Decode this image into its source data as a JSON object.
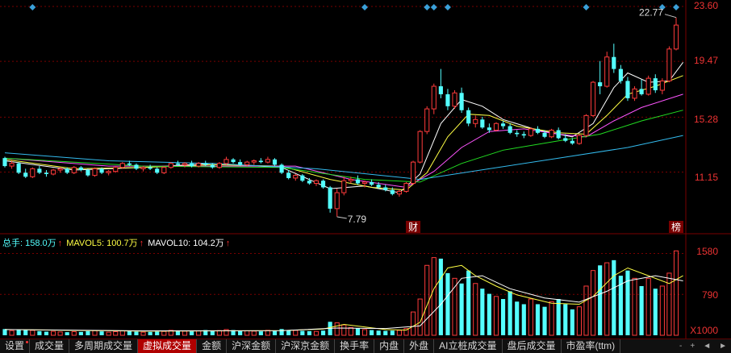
{
  "price_axis": {
    "labels": [
      "23.60",
      "19.47",
      "15.28",
      "11.15"
    ]
  },
  "volume_axis": {
    "labels": [
      "1580",
      "790",
      "X1000"
    ]
  },
  "annotations": {
    "high": "22.77",
    "low": "7.79",
    "finance_marker": "财",
    "ranking_marker": "榜"
  },
  "legend": {
    "total_label": "总手: 158.0万",
    "mavol5_label": "MAVOL5: 100.7万",
    "mavol10_label": "MAVOL10: 104.2万",
    "arrow_glyph": "↑"
  },
  "colors": {
    "up": "#ff3b3b",
    "down": "#54ffff",
    "ma5": "#ffffff",
    "ma10": "#ffff44",
    "ma20": "#ff55ff",
    "ma30": "#22dd22",
    "ma60": "#33bbee",
    "grid": "#7a0000"
  },
  "tabs": [
    {
      "label": "设置",
      "active": false
    },
    {
      "label": "成交量",
      "active": false
    },
    {
      "label": "多周期成交量",
      "active": false
    },
    {
      "label": "虚拟成交量",
      "active": true
    },
    {
      "label": "金额",
      "active": false
    },
    {
      "label": "沪深金额",
      "active": false
    },
    {
      "label": "沪深京金额",
      "active": false
    },
    {
      "label": "换手率",
      "active": false
    },
    {
      "label": "内盘",
      "active": false
    },
    {
      "label": "外盘",
      "active": false
    },
    {
      "label": "AI立桩成交量",
      "active": false
    },
    {
      "label": "盘后成交量",
      "active": false
    },
    {
      "label": "市盈率(ttm)",
      "active": false
    }
  ],
  "tab_controls": {
    "minus_icon": "-",
    "plus_icon": "+",
    "left_icon": "◄",
    "right_icon": "►"
  },
  "chart_data": {
    "type": "candlestick",
    "price_ylim": [
      7.0,
      23.6
    ],
    "volume_ylim": [
      0,
      1650
    ],
    "price_ticks": [
      23.6,
      19.47,
      15.28,
      11.15
    ],
    "volume_ticks": [
      1580,
      790
    ],
    "bars": [
      [
        12.2,
        12.3,
        11.5,
        11.6,
        120
      ],
      [
        11.6,
        12.0,
        11.4,
        11.8,
        90
      ],
      [
        11.8,
        11.9,
        11.0,
        11.1,
        110
      ],
      [
        11.1,
        11.4,
        10.7,
        10.8,
        100
      ],
      [
        10.8,
        11.5,
        10.7,
        11.4,
        95
      ],
      [
        11.4,
        11.6,
        11.0,
        11.1,
        80
      ],
      [
        11.1,
        11.3,
        10.8,
        11.0,
        70
      ],
      [
        11.0,
        11.4,
        10.9,
        11.3,
        75
      ],
      [
        11.3,
        11.5,
        11.1,
        11.4,
        65
      ],
      [
        11.4,
        11.5,
        11.0,
        11.1,
        60
      ],
      [
        11.1,
        11.6,
        11.0,
        11.5,
        70
      ],
      [
        11.5,
        11.6,
        11.2,
        11.3,
        65
      ],
      [
        11.3,
        11.4,
        10.8,
        10.9,
        80
      ],
      [
        10.9,
        11.5,
        10.8,
        11.4,
        90
      ],
      [
        11.4,
        11.5,
        11.0,
        11.1,
        75
      ],
      [
        11.1,
        11.3,
        10.9,
        11.2,
        60
      ],
      [
        11.2,
        11.6,
        11.1,
        11.5,
        70
      ],
      [
        11.5,
        11.9,
        11.4,
        11.8,
        85
      ],
      [
        11.8,
        12.0,
        11.6,
        11.7,
        80
      ],
      [
        11.7,
        11.8,
        11.3,
        11.4,
        70
      ],
      [
        11.4,
        11.6,
        11.2,
        11.5,
        60
      ],
      [
        11.5,
        11.7,
        11.3,
        11.4,
        65
      ],
      [
        11.4,
        11.5,
        11.0,
        11.1,
        70
      ],
      [
        11.1,
        11.6,
        11.0,
        11.5,
        75
      ],
      [
        11.5,
        11.9,
        11.4,
        11.8,
        95
      ],
      [
        11.8,
        12.0,
        11.6,
        11.7,
        90
      ],
      [
        11.7,
        11.9,
        11.5,
        11.8,
        80
      ],
      [
        11.8,
        12.0,
        11.5,
        11.6,
        75
      ],
      [
        11.6,
        11.9,
        11.5,
        11.8,
        85
      ],
      [
        11.8,
        12.0,
        11.6,
        11.7,
        100
      ],
      [
        11.7,
        11.8,
        11.4,
        11.5,
        80
      ],
      [
        11.5,
        11.9,
        11.4,
        11.8,
        90
      ],
      [
        11.8,
        12.3,
        11.7,
        12.1,
        110
      ],
      [
        12.1,
        12.2,
        11.8,
        11.9,
        100
      ],
      [
        11.9,
        12.1,
        11.6,
        11.7,
        90
      ],
      [
        11.7,
        12.0,
        11.6,
        11.9,
        85
      ],
      [
        11.9,
        12.1,
        11.7,
        12.0,
        80
      ],
      [
        12.0,
        12.2,
        11.8,
        11.9,
        75
      ],
      [
        11.9,
        12.3,
        11.8,
        12.1,
        95
      ],
      [
        12.1,
        12.2,
        11.6,
        11.7,
        90
      ],
      [
        11.7,
        11.8,
        11.0,
        11.1,
        120
      ],
      [
        11.1,
        11.3,
        10.6,
        10.7,
        100
      ],
      [
        10.7,
        11.0,
        10.5,
        10.9,
        95
      ],
      [
        10.9,
        11.0,
        10.4,
        10.5,
        85
      ],
      [
        10.5,
        10.7,
        10.2,
        10.3,
        80
      ],
      [
        10.3,
        10.6,
        10.1,
        10.5,
        75
      ],
      [
        10.5,
        10.6,
        9.9,
        10.0,
        90
      ],
      [
        10.0,
        10.1,
        8.1,
        8.4,
        260
      ],
      [
        8.4,
        9.9,
        7.79,
        9.6,
        240
      ],
      [
        9.6,
        10.8,
        9.4,
        10.5,
        200
      ],
      [
        10.5,
        10.8,
        10.3,
        10.6,
        150
      ],
      [
        10.6,
        10.9,
        10.2,
        10.3,
        140
      ],
      [
        10.3,
        10.5,
        10.0,
        10.4,
        110
      ],
      [
        10.4,
        10.6,
        10.1,
        10.2,
        100
      ],
      [
        10.2,
        10.4,
        9.9,
        10.0,
        90
      ],
      [
        10.0,
        10.2,
        9.7,
        9.8,
        85
      ],
      [
        9.8,
        10.0,
        9.4,
        9.5,
        90
      ],
      [
        9.5,
        9.8,
        9.3,
        9.7,
        95
      ],
      [
        9.7,
        10.4,
        9.6,
        10.3,
        130
      ],
      [
        10.3,
        12.0,
        10.2,
        11.9,
        450
      ],
      [
        11.9,
        14.3,
        11.8,
        14.2,
        700
      ],
      [
        14.2,
        16.1,
        14.0,
        15.9,
        1350
      ],
      [
        15.9,
        17.8,
        15.5,
        17.6,
        1500
      ],
      [
        17.6,
        18.9,
        16.7,
        17.0,
        1480
      ],
      [
        17.0,
        17.4,
        15.8,
        16.1,
        1200
      ],
      [
        16.1,
        17.3,
        15.9,
        17.1,
        1100
      ],
      [
        17.1,
        17.5,
        15.6,
        15.8,
        1000
      ],
      [
        15.8,
        16.0,
        14.6,
        14.8,
        1250
      ],
      [
        14.8,
        15.4,
        14.5,
        15.1,
        1000
      ],
      [
        15.1,
        15.3,
        14.4,
        14.5,
        900
      ],
      [
        14.5,
        14.8,
        14.1,
        14.3,
        800
      ],
      [
        14.3,
        14.9,
        14.2,
        14.8,
        750
      ],
      [
        14.8,
        15.0,
        14.4,
        14.6,
        700
      ],
      [
        14.6,
        14.8,
        14.0,
        14.1,
        850
      ],
      [
        14.1,
        14.3,
        13.8,
        14.0,
        650
      ],
      [
        14.0,
        14.2,
        13.7,
        13.9,
        600
      ],
      [
        13.9,
        14.5,
        13.8,
        14.4,
        700
      ],
      [
        14.4,
        14.6,
        14.0,
        14.1,
        600
      ],
      [
        14.1,
        14.3,
        13.7,
        13.8,
        550
      ],
      [
        13.8,
        14.4,
        13.7,
        14.3,
        650
      ],
      [
        14.3,
        14.5,
        13.6,
        13.7,
        700
      ],
      [
        13.7,
        14.0,
        13.4,
        13.5,
        600
      ],
      [
        13.5,
        13.7,
        13.2,
        13.3,
        500
      ],
      [
        13.3,
        14.0,
        13.2,
        13.9,
        550
      ],
      [
        13.9,
        15.5,
        13.8,
        15.4,
        950
      ],
      [
        15.4,
        18.0,
        15.3,
        17.9,
        1250
      ],
      [
        17.9,
        19.5,
        17.0,
        17.6,
        1350
      ],
      [
        17.6,
        20.2,
        17.5,
        19.8,
        1400
      ],
      [
        19.8,
        20.8,
        18.6,
        18.9,
        1450
      ],
      [
        18.9,
        19.2,
        17.8,
        18.0,
        1150
      ],
      [
        18.0,
        18.3,
        16.5,
        16.7,
        1250
      ],
      [
        16.7,
        17.6,
        16.5,
        17.4,
        1100
      ],
      [
        17.4,
        18.1,
        16.9,
        17.0,
        950
      ],
      [
        17.0,
        18.4,
        16.9,
        18.2,
        1100
      ],
      [
        18.2,
        18.5,
        17.1,
        17.3,
        900
      ],
      [
        17.3,
        18.2,
        17.0,
        18.0,
        950
      ],
      [
        18.0,
        20.6,
        17.9,
        20.4,
        1200
      ],
      [
        20.4,
        22.77,
        20.3,
        22.2,
        1630
      ]
    ],
    "ma": {
      "ma5": [
        [
          0,
          12.0
        ],
        [
          10,
          11.3
        ],
        [
          20,
          11.5
        ],
        [
          30,
          11.8
        ],
        [
          40,
          11.5
        ],
        [
          47,
          9.9
        ],
        [
          52,
          10.1
        ],
        [
          57,
          9.6
        ],
        [
          60,
          11.0
        ],
        [
          63,
          14.8
        ],
        [
          66,
          16.6
        ],
        [
          69,
          16.1
        ],
        [
          72,
          15.1
        ],
        [
          77,
          14.3
        ],
        [
          82,
          13.8
        ],
        [
          85,
          14.8
        ],
        [
          88,
          17.5
        ],
        [
          90,
          18.6
        ],
        [
          93,
          17.9
        ],
        [
          96,
          18.0
        ],
        [
          98,
          19.4
        ]
      ],
      "ma10": [
        [
          0,
          12.1
        ],
        [
          10,
          11.4
        ],
        [
          20,
          11.5
        ],
        [
          30,
          11.7
        ],
        [
          40,
          11.6
        ],
        [
          47,
          10.6
        ],
        [
          53,
          10.0
        ],
        [
          58,
          9.8
        ],
        [
          61,
          11.1
        ],
        [
          64,
          13.8
        ],
        [
          67,
          15.5
        ],
        [
          70,
          15.4
        ],
        [
          74,
          14.6
        ],
        [
          80,
          14.1
        ],
        [
          84,
          14.0
        ],
        [
          87,
          15.4
        ],
        [
          90,
          17.0
        ],
        [
          94,
          17.6
        ],
        [
          98,
          18.4
        ]
      ],
      "ma20": [
        [
          0,
          12.2
        ],
        [
          15,
          11.6
        ],
        [
          30,
          11.6
        ],
        [
          42,
          11.6
        ],
        [
          50,
          10.6
        ],
        [
          58,
          10.0
        ],
        [
          62,
          11.2
        ],
        [
          66,
          13.0
        ],
        [
          70,
          14.2
        ],
        [
          75,
          14.4
        ],
        [
          80,
          14.0
        ],
        [
          84,
          13.8
        ],
        [
          88,
          15.0
        ],
        [
          92,
          16.0
        ],
        [
          98,
          17.0
        ]
      ],
      "ma30": [
        [
          0,
          12.2
        ],
        [
          20,
          11.6
        ],
        [
          40,
          11.5
        ],
        [
          52,
          10.6
        ],
        [
          60,
          10.4
        ],
        [
          66,
          11.8
        ],
        [
          72,
          12.8
        ],
        [
          80,
          13.5
        ],
        [
          86,
          14.0
        ],
        [
          92,
          15.0
        ],
        [
          98,
          15.8
        ]
      ],
      "ma60": [
        [
          0,
          12.6
        ],
        [
          15,
          12.0
        ],
        [
          30,
          11.8
        ],
        [
          45,
          11.4
        ],
        [
          60,
          10.6
        ],
        [
          70,
          11.4
        ],
        [
          80,
          12.2
        ],
        [
          90,
          13.0
        ],
        [
          98,
          13.9
        ]
      ]
    },
    "volume_ma": {
      "mavol5": [
        [
          0,
          110
        ],
        [
          20,
          80
        ],
        [
          40,
          90
        ],
        [
          46,
          120
        ],
        [
          49,
          210
        ],
        [
          55,
          110
        ],
        [
          58,
          100
        ],
        [
          60,
          250
        ],
        [
          62,
          900
        ],
        [
          64,
          1300
        ],
        [
          66,
          1350
        ],
        [
          68,
          1150
        ],
        [
          71,
          950
        ],
        [
          74,
          780
        ],
        [
          79,
          620
        ],
        [
          83,
          600
        ],
        [
          85,
          750
        ],
        [
          88,
          1150
        ],
        [
          90,
          1300
        ],
        [
          93,
          1150
        ],
        [
          96,
          1000
        ],
        [
          98,
          1150
        ]
      ],
      "mavol10": [
        [
          0,
          110
        ],
        [
          20,
          85
        ],
        [
          40,
          88
        ],
        [
          48,
          140
        ],
        [
          55,
          130
        ],
        [
          60,
          180
        ],
        [
          63,
          600
        ],
        [
          66,
          1100
        ],
        [
          69,
          1150
        ],
        [
          73,
          900
        ],
        [
          78,
          720
        ],
        [
          83,
          640
        ],
        [
          87,
          850
        ],
        [
          90,
          1050
        ],
        [
          94,
          1150
        ],
        [
          98,
          1050
        ]
      ]
    },
    "markers": {
      "diamonds_bar_index": [
        4,
        52,
        61,
        62,
        64,
        84,
        95,
        97
      ]
    }
  }
}
